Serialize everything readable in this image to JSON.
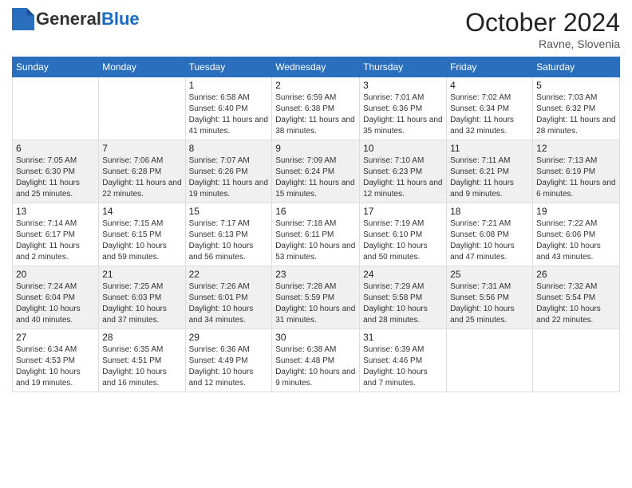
{
  "header": {
    "logo_general": "General",
    "logo_blue": "Blue",
    "month_title": "October 2024",
    "location": "Ravne, Slovenia"
  },
  "weekdays": [
    "Sunday",
    "Monday",
    "Tuesday",
    "Wednesday",
    "Thursday",
    "Friday",
    "Saturday"
  ],
  "weeks": [
    [
      {
        "day": "",
        "info": ""
      },
      {
        "day": "",
        "info": ""
      },
      {
        "day": "1",
        "info": "Sunrise: 6:58 AM\nSunset: 6:40 PM\nDaylight: 11 hours and 41 minutes."
      },
      {
        "day": "2",
        "info": "Sunrise: 6:59 AM\nSunset: 6:38 PM\nDaylight: 11 hours and 38 minutes."
      },
      {
        "day": "3",
        "info": "Sunrise: 7:01 AM\nSunset: 6:36 PM\nDaylight: 11 hours and 35 minutes."
      },
      {
        "day": "4",
        "info": "Sunrise: 7:02 AM\nSunset: 6:34 PM\nDaylight: 11 hours and 32 minutes."
      },
      {
        "day": "5",
        "info": "Sunrise: 7:03 AM\nSunset: 6:32 PM\nDaylight: 11 hours and 28 minutes."
      }
    ],
    [
      {
        "day": "6",
        "info": "Sunrise: 7:05 AM\nSunset: 6:30 PM\nDaylight: 11 hours and 25 minutes."
      },
      {
        "day": "7",
        "info": "Sunrise: 7:06 AM\nSunset: 6:28 PM\nDaylight: 11 hours and 22 minutes."
      },
      {
        "day": "8",
        "info": "Sunrise: 7:07 AM\nSunset: 6:26 PM\nDaylight: 11 hours and 19 minutes."
      },
      {
        "day": "9",
        "info": "Sunrise: 7:09 AM\nSunset: 6:24 PM\nDaylight: 11 hours and 15 minutes."
      },
      {
        "day": "10",
        "info": "Sunrise: 7:10 AM\nSunset: 6:23 PM\nDaylight: 11 hours and 12 minutes."
      },
      {
        "day": "11",
        "info": "Sunrise: 7:11 AM\nSunset: 6:21 PM\nDaylight: 11 hours and 9 minutes."
      },
      {
        "day": "12",
        "info": "Sunrise: 7:13 AM\nSunset: 6:19 PM\nDaylight: 11 hours and 6 minutes."
      }
    ],
    [
      {
        "day": "13",
        "info": "Sunrise: 7:14 AM\nSunset: 6:17 PM\nDaylight: 11 hours and 2 minutes."
      },
      {
        "day": "14",
        "info": "Sunrise: 7:15 AM\nSunset: 6:15 PM\nDaylight: 10 hours and 59 minutes."
      },
      {
        "day": "15",
        "info": "Sunrise: 7:17 AM\nSunset: 6:13 PM\nDaylight: 10 hours and 56 minutes."
      },
      {
        "day": "16",
        "info": "Sunrise: 7:18 AM\nSunset: 6:11 PM\nDaylight: 10 hours and 53 minutes."
      },
      {
        "day": "17",
        "info": "Sunrise: 7:19 AM\nSunset: 6:10 PM\nDaylight: 10 hours and 50 minutes."
      },
      {
        "day": "18",
        "info": "Sunrise: 7:21 AM\nSunset: 6:08 PM\nDaylight: 10 hours and 47 minutes."
      },
      {
        "day": "19",
        "info": "Sunrise: 7:22 AM\nSunset: 6:06 PM\nDaylight: 10 hours and 43 minutes."
      }
    ],
    [
      {
        "day": "20",
        "info": "Sunrise: 7:24 AM\nSunset: 6:04 PM\nDaylight: 10 hours and 40 minutes."
      },
      {
        "day": "21",
        "info": "Sunrise: 7:25 AM\nSunset: 6:03 PM\nDaylight: 10 hours and 37 minutes."
      },
      {
        "day": "22",
        "info": "Sunrise: 7:26 AM\nSunset: 6:01 PM\nDaylight: 10 hours and 34 minutes."
      },
      {
        "day": "23",
        "info": "Sunrise: 7:28 AM\nSunset: 5:59 PM\nDaylight: 10 hours and 31 minutes."
      },
      {
        "day": "24",
        "info": "Sunrise: 7:29 AM\nSunset: 5:58 PM\nDaylight: 10 hours and 28 minutes."
      },
      {
        "day": "25",
        "info": "Sunrise: 7:31 AM\nSunset: 5:56 PM\nDaylight: 10 hours and 25 minutes."
      },
      {
        "day": "26",
        "info": "Sunrise: 7:32 AM\nSunset: 5:54 PM\nDaylight: 10 hours and 22 minutes."
      }
    ],
    [
      {
        "day": "27",
        "info": "Sunrise: 6:34 AM\nSunset: 4:53 PM\nDaylight: 10 hours and 19 minutes."
      },
      {
        "day": "28",
        "info": "Sunrise: 6:35 AM\nSunset: 4:51 PM\nDaylight: 10 hours and 16 minutes."
      },
      {
        "day": "29",
        "info": "Sunrise: 6:36 AM\nSunset: 4:49 PM\nDaylight: 10 hours and 12 minutes."
      },
      {
        "day": "30",
        "info": "Sunrise: 6:38 AM\nSunset: 4:48 PM\nDaylight: 10 hours and 9 minutes."
      },
      {
        "day": "31",
        "info": "Sunrise: 6:39 AM\nSunset: 4:46 PM\nDaylight: 10 hours and 7 minutes."
      },
      {
        "day": "",
        "info": ""
      },
      {
        "day": "",
        "info": ""
      }
    ]
  ]
}
